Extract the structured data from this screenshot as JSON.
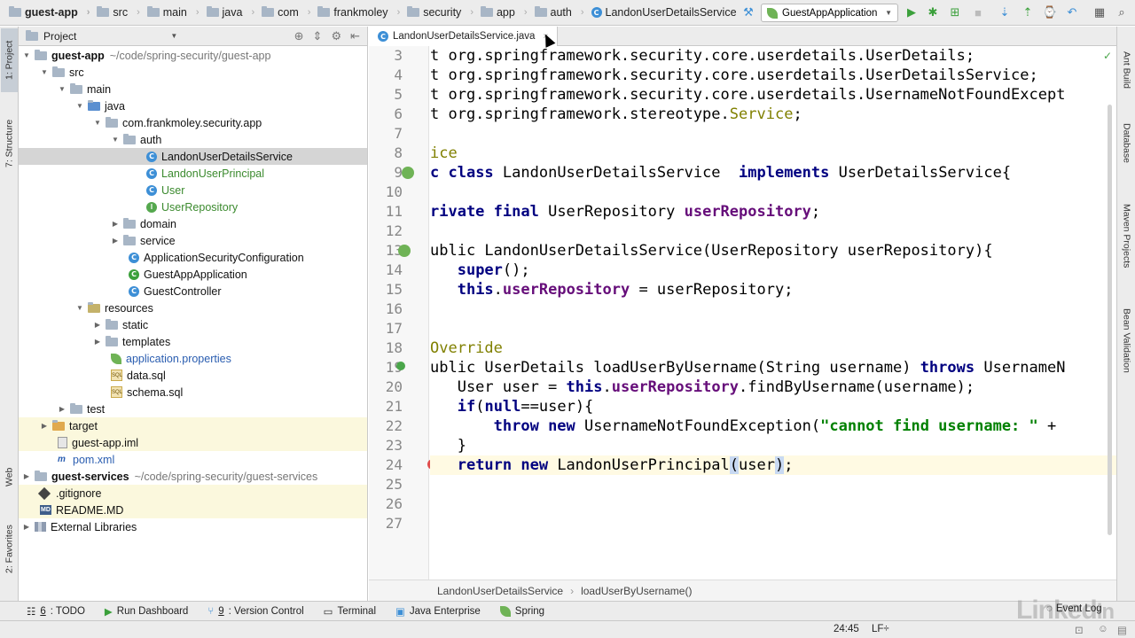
{
  "navbar": {
    "breadcrumbs": [
      "guest-app",
      "src",
      "main",
      "java",
      "com",
      "frankmoley",
      "security",
      "app",
      "auth",
      "LandonUserDetailsService"
    ],
    "run_config": "GuestAppApplication"
  },
  "left_strip": {
    "project_tab": "1: Project",
    "structure_tab": "7: Structure",
    "web_tab": "Web",
    "favorites_tab": "2: Favorites"
  },
  "right_strip": {
    "ant_tab": "Ant Build",
    "database_tab": "Database",
    "maven_tab": "Maven Projects",
    "bean_tab": "Bean Validation"
  },
  "project_panel": {
    "title": "Project",
    "tree": [
      {
        "label": "guest-app",
        "extra": "~/code/spring-security/guest-app"
      },
      {
        "label": "src"
      },
      {
        "label": "main"
      },
      {
        "label": "java"
      },
      {
        "label": "com.frankmoley.security.app"
      },
      {
        "label": "auth"
      },
      {
        "label": "LandonUserDetailsService"
      },
      {
        "label": "LandonUserPrincipal"
      },
      {
        "label": "User"
      },
      {
        "label": "UserRepository"
      },
      {
        "label": "domain"
      },
      {
        "label": "service"
      },
      {
        "label": "ApplicationSecurityConfiguration"
      },
      {
        "label": "GuestAppApplication"
      },
      {
        "label": "GuestController"
      },
      {
        "label": "resources"
      },
      {
        "label": "static"
      },
      {
        "label": "templates"
      },
      {
        "label": "application.properties"
      },
      {
        "label": "data.sql"
      },
      {
        "label": "schema.sql"
      },
      {
        "label": "test"
      },
      {
        "label": "target"
      },
      {
        "label": "guest-app.iml"
      },
      {
        "label": "pom.xml"
      },
      {
        "label": "guest-services",
        "extra": "~/code/spring-security/guest-services"
      },
      {
        "label": ".gitignore"
      },
      {
        "label": "README.MD"
      },
      {
        "label": "External Libraries"
      }
    ]
  },
  "editor": {
    "tab": "LandonUserDetailsService.java",
    "line_numbers": [
      "3",
      "4",
      "5",
      "6",
      "7",
      "8",
      "9",
      "10",
      "11",
      "12",
      "13",
      "14",
      "15",
      "16",
      "17",
      "18",
      "19",
      "20",
      "21",
      "22",
      "23",
      "24",
      "25",
      "26",
      "27"
    ],
    "lines": {
      "l3": "t org.springframework.security.core.userdetails.UserDetails;",
      "l4": "t org.springframework.security.core.userdetails.UserDetailsService;",
      "l5": "t org.springframework.security.core.userdetails.UsernameNotFoundExcept",
      "l6a": "t org.springframework.",
      "l6b": "stereotype",
      "l6c": ".",
      "l6d": "Service",
      "l6e": ";",
      "l8": "ice",
      "l9a": "c ",
      "l9b": "class",
      "l9c": " LandonUserDetailsService  ",
      "l9d": "implements",
      "l9e": " UserDetailsService{",
      "l11a": "rivate ",
      "l11b": "final",
      "l11c": " UserRepository ",
      "l11d": "userRepository",
      "l11e": ";",
      "l13": "ublic LandonUserDetailsService(UserRepository userRepository){",
      "l14a": "   ",
      "l14b": "super",
      "l14c": "();",
      "l15a": "   ",
      "l15b": "this",
      "l15c": ".",
      "l15d": "userRepository",
      "l15e": " = userRepository;",
      "l18": "Override",
      "l19a": "ublic UserDetails loadUserByUsername(String username) ",
      "l19b": "throws",
      "l19c": " UsernameN",
      "l20a": "   User user = ",
      "l20b": "this",
      "l20c": ".",
      "l20d": "userRepository",
      "l20e": ".findByUsername(username);",
      "l21a": "   ",
      "l21b": "if",
      "l21c": "(",
      "l21d": "null",
      "l21e": "==user){",
      "l22a": "       ",
      "l22b": "throw new",
      "l22c": " UsernameNotFoundException(",
      "l22d": "\"cannot find username: \"",
      "l22e": " +",
      "l23": "   }",
      "l24a": "   ",
      "l24b": "return new",
      "l24c": " LandonUserPrincipal",
      "l24d": "(",
      "l24e": "user",
      "l24f": ")",
      "l24g": ";"
    },
    "breadcrumb": [
      "LandonUserDetailsService",
      "loadUserByUsername()"
    ]
  },
  "bottom_tools": {
    "todo_num": "6",
    "todo": ": TODO",
    "run_dashboard": "Run Dashboard",
    "vc_num": "9",
    "vc": ": Version Control",
    "terminal": "Terminal",
    "java_enterprise": "Java Enterprise",
    "spring": "Spring",
    "event_log": "Event Log"
  },
  "status": {
    "position": "24:45",
    "line_ending": "LF÷"
  },
  "colors": {
    "keyword": "#000080",
    "field": "#660e7a",
    "string": "#008000",
    "annotation": "#808000"
  }
}
